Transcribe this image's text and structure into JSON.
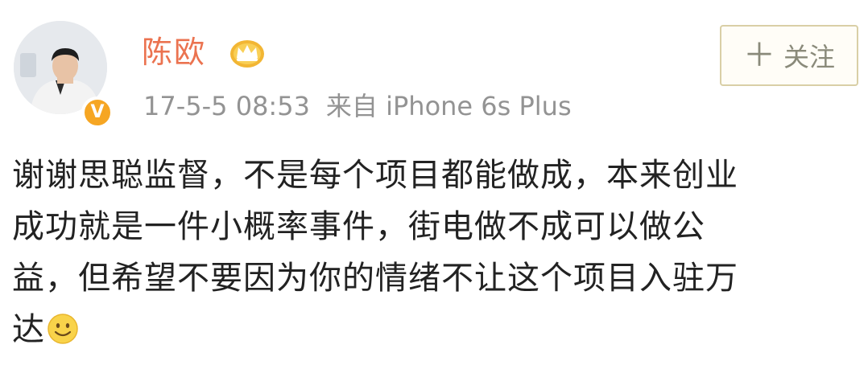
{
  "post": {
    "author": {
      "name": "陈欧",
      "avatar_badge": "V",
      "vip_icon": "crown-icon",
      "verified_icon": "verified-badge-icon",
      "badge_color": "#f6a623",
      "name_color": "#eb7350"
    },
    "meta": {
      "timestamp": "17-5-5 08:53",
      "source": "来自 iPhone 6s Plus"
    },
    "follow_button": {
      "icon": "plus-icon",
      "label": "关注"
    },
    "text_lines": [
      "谢谢思聪监督，不是每个项目都能做成，本来创业",
      "成功就是一件小概率事件，街电做不成可以做公",
      "益，但希望不要因为你的情绪不让这个项目入驻万",
      "达"
    ],
    "emoji_icon": "smile-icon"
  }
}
